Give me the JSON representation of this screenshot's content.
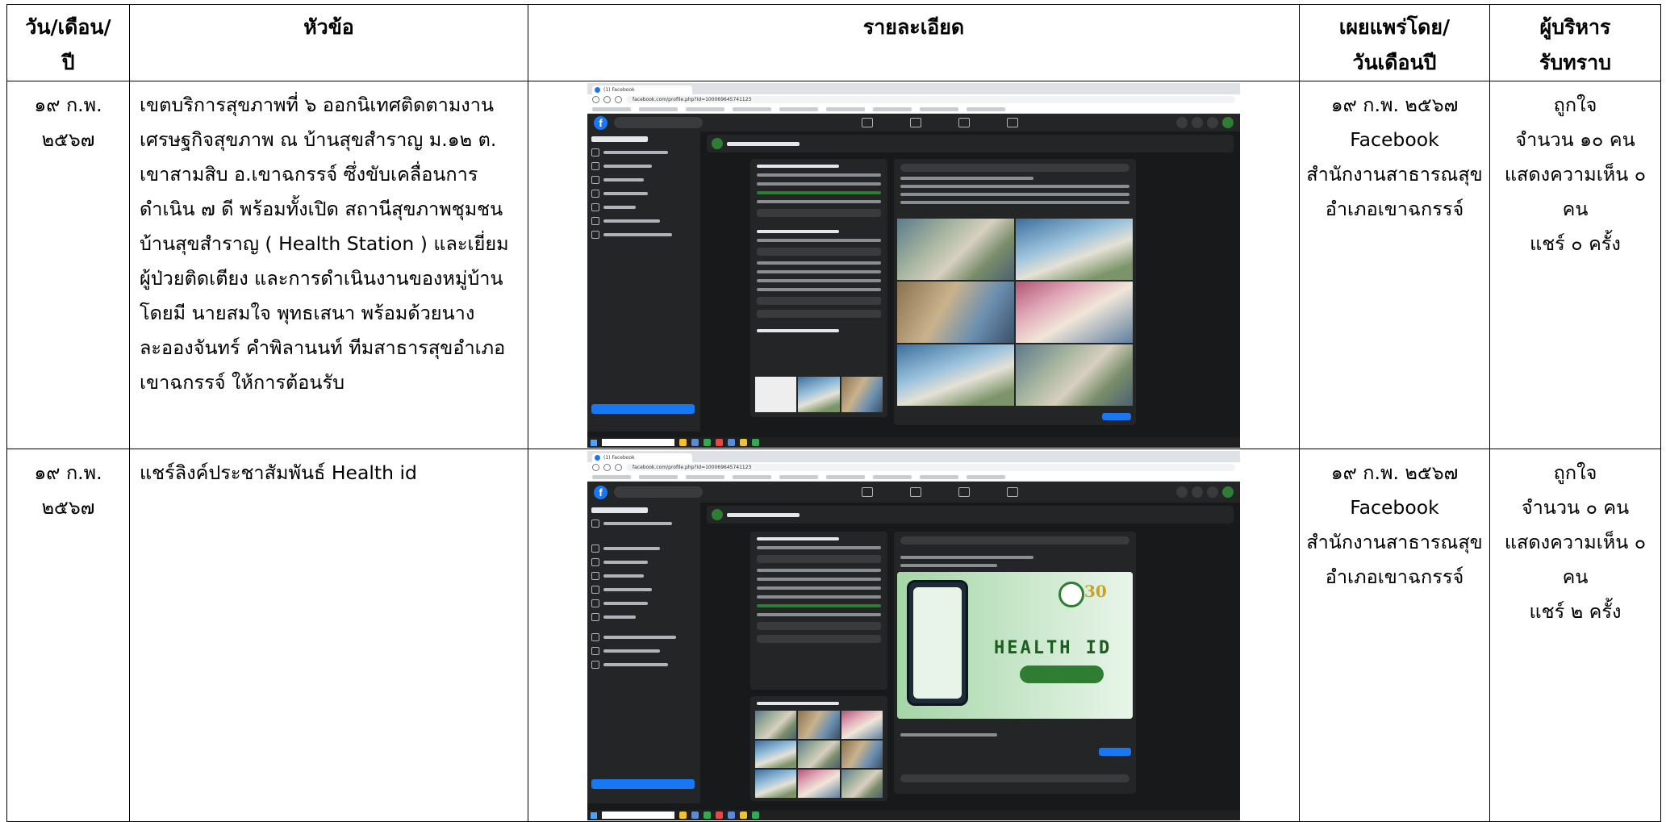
{
  "headers": {
    "date": [
      "วัน/เดือน/",
      "ปี"
    ],
    "topic": "หัวข้อ",
    "detail": "รายละเอียด",
    "published": [
      "เผยแพร่โดย/",
      "วันเดือนปี"
    ],
    "executive": [
      "ผู้บริหาร",
      "รับทราบ"
    ]
  },
  "rows": [
    {
      "date": [
        "๑๙ ก.พ.",
        "๒๕๖๗"
      ],
      "topic": [
        "เขตบริการสุขภาพที่ ๖ ออกนิเทศติดตามงาน",
        "เศรษฐกิจสุขภาพ ณ บ้านสุขสำราญ ม.๑๒ ต.",
        "เขาสามสิบ อ.เขาฉกรรจ์ ซึ่งขับเคลื่อนการ",
        "ดำเนิน ๗ ดี พร้อมทั้งเปิด สถานีสุขภาพชุมชน",
        "บ้านสุขสำราญ ( Health Station ) และเยี่ยม",
        "ผู้ป่วยติดเตียง และการดำเนินงานของหมู่บ้าน",
        "โดยมี นายสมใจ พุทธเสนา พร้อมด้วยนาง",
        "ละอองจันทร์ คำพิลานนท์ ทีมสาธารสุขอำเภอ",
        "เขาฉกรรจ์ ให้การต้อนรับ"
      ],
      "published": [
        "๑๙ ก.พ. ๒๕๖๗",
        "Facebook",
        "สำนักงานสาธารณสุข",
        "อำเภอเขาฉกรรจ์"
      ],
      "executive": [
        "ถูกใจ",
        "จำนวน ๑๐ คน",
        "แสดงความเห็น ๐",
        "คน",
        "แชร์ ๐ ครั้ง"
      ]
    },
    {
      "date": [
        "๑๙ ก.พ.",
        "๒๕๖๗"
      ],
      "topic": [
        "แชร์ลิงค์ประชาสัมพันธ์ Health id"
      ],
      "published": [
        "๑๙ ก.พ. ๒๕๖๗",
        "Facebook",
        "สำนักงานสาธารณสุข",
        "อำเภอเขาฉกรรจ์"
      ],
      "executive": [
        "ถูกใจ",
        "จำนวน ๐ คน",
        "แสดงความเห็น ๐",
        "คน",
        "แชร์ ๒ ครั้ง"
      ]
    }
  ],
  "screenshots": {
    "tab_label": "(1) Facebook",
    "url": "facebook.com/profile.php?id=100069645741123",
    "fb_logo": "f",
    "health_id_title": "HEALTH ID",
    "logo_30": "30"
  }
}
